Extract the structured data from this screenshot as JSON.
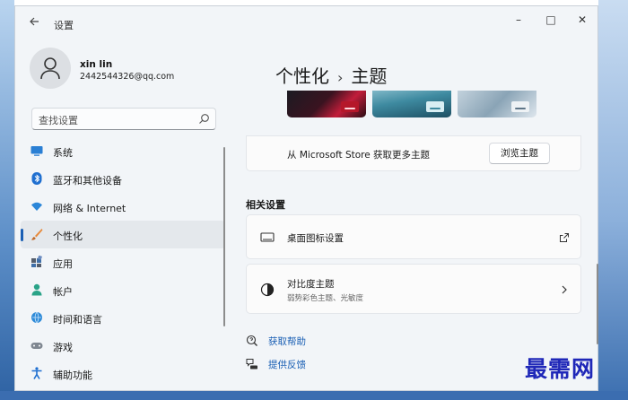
{
  "window": {
    "title": "设置",
    "controls": {
      "minimize": "–",
      "maximize": "□",
      "close": "✕"
    }
  },
  "user": {
    "name": "xin lin",
    "email": "2442544326@qq.com"
  },
  "search": {
    "placeholder": "查找设置"
  },
  "sidebar": {
    "items": [
      {
        "label": "系统",
        "icon": "monitor-icon",
        "active": false
      },
      {
        "label": "蓝牙和其他设备",
        "icon": "bluetooth-icon",
        "active": false
      },
      {
        "label": "网络 & Internet",
        "icon": "wifi-icon",
        "active": false
      },
      {
        "label": "个性化",
        "icon": "brush-icon",
        "active": true
      },
      {
        "label": "应用",
        "icon": "apps-icon",
        "active": false
      },
      {
        "label": "帐户",
        "icon": "account-icon",
        "active": false
      },
      {
        "label": "时间和语言",
        "icon": "globe-clock-icon",
        "active": false
      },
      {
        "label": "游戏",
        "icon": "gamepad-icon",
        "active": false
      },
      {
        "label": "辅助功能",
        "icon": "accessibility-icon",
        "active": false
      }
    ]
  },
  "breadcrumb": {
    "parent": "个性化",
    "separator": "›",
    "current": "主题"
  },
  "themes": {
    "store_text": "从 Microsoft Store 获取更多主题",
    "browse_label": "浏览主题"
  },
  "related": {
    "title": "相关设置",
    "desktop_icons": {
      "title": "桌面图标设置"
    },
    "contrast": {
      "title": "对比度主题",
      "subtitle": "弱势彩色主题、光敏度"
    }
  },
  "links": {
    "help": "获取帮助",
    "feedback": "提供反馈"
  },
  "watermark": "最需网",
  "colors": {
    "accent": "#1a5fb4",
    "background": "#f2f5f8",
    "card": "#fbfbfb"
  }
}
